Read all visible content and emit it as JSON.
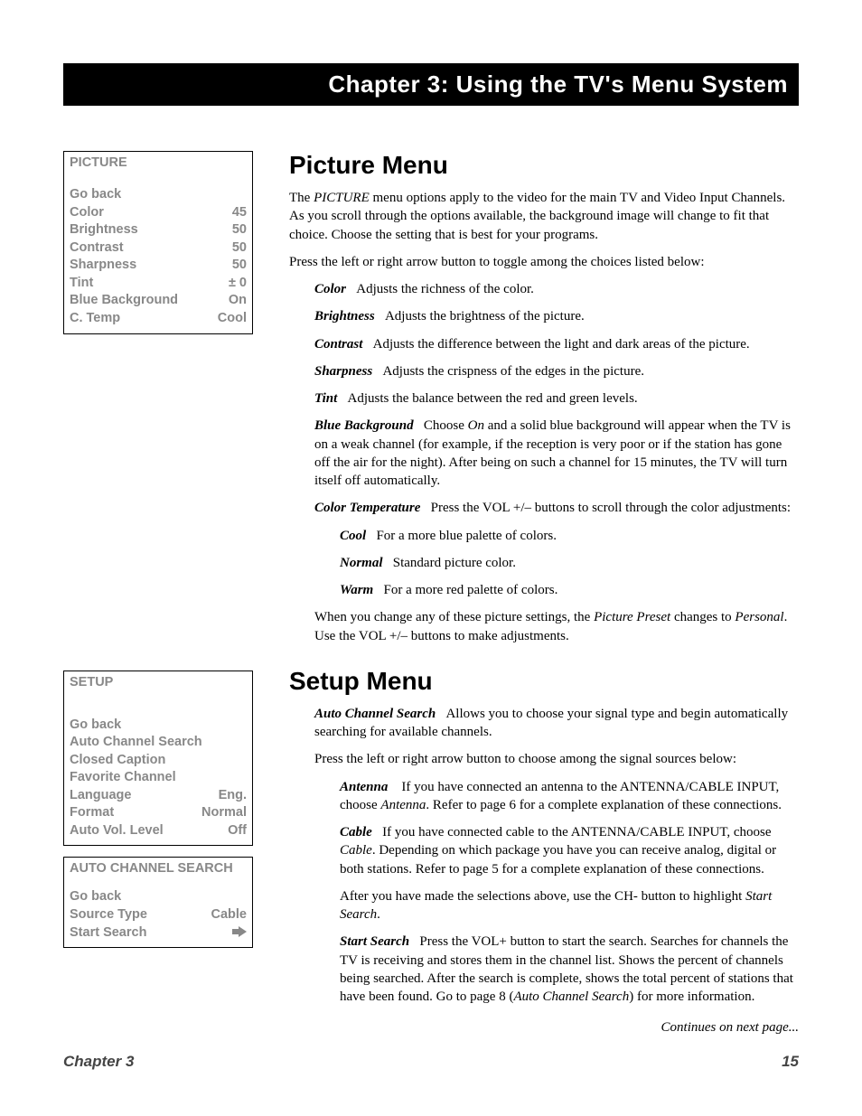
{
  "chapter_banner": "Chapter 3: Using the TV's Menu System",
  "sidebar": {
    "picture_menu": {
      "title": "PICTURE",
      "go_back": "Go back",
      "rows": [
        {
          "label": "Color",
          "value": "45"
        },
        {
          "label": "Brightness",
          "value": "50"
        },
        {
          "label": "Contrast",
          "value": "50"
        },
        {
          "label": "Sharpness",
          "value": "50"
        },
        {
          "label": "Tint",
          "value": "±  0"
        },
        {
          "label": "Blue Background",
          "value": "On"
        },
        {
          "label": "C. Temp",
          "value": "Cool"
        }
      ]
    },
    "setup_menu": {
      "title": "SETUP",
      "go_back": "Go back",
      "rows": [
        {
          "label": "Auto Channel Search",
          "value": ""
        },
        {
          "label": "Closed Caption",
          "value": ""
        },
        {
          "label": "Favorite Channel",
          "value": ""
        },
        {
          "label": "Language",
          "value": "Eng."
        },
        {
          "label": "Format",
          "value": "Normal"
        },
        {
          "label": "Auto Vol. Level",
          "value": "Off"
        }
      ]
    },
    "auto_channel_menu": {
      "title": "AUTO CHANNEL SEARCH",
      "go_back": "Go back",
      "rows": [
        {
          "label": "Source Type",
          "value": "Cable"
        },
        {
          "label": "Start Search",
          "value": "arrow"
        }
      ]
    }
  },
  "main": {
    "picture_heading": "Picture Menu",
    "picture_intro_pre": "The ",
    "picture_intro_italic": "PICTURE",
    "picture_intro_post": " menu options apply to the video for the main TV and Video Input Channels. As you scroll through the options available, the background image will change to fit that choice. Choose the setting that is best for your programs.",
    "picture_press": "Press the left or right arrow button to toggle among the choices listed below:",
    "defs": {
      "color": {
        "term": "Color",
        "desc": "Adjusts the richness of the color."
      },
      "brightness": {
        "term": "Brightness",
        "desc": "Adjusts the brightness of the picture."
      },
      "contrast": {
        "term": "Contrast",
        "desc": "Adjusts the difference between the light and dark areas of the picture."
      },
      "sharpness": {
        "term": "Sharpness",
        "desc": "Adjusts the crispness of the edges in the picture."
      },
      "tint": {
        "term": "Tint",
        "desc": "Adjusts the balance between the red and green levels."
      },
      "bluebg": {
        "term": "Blue Background",
        "desc_pre": "Choose ",
        "desc_italic": "On",
        "desc_post": " and a solid blue background will appear when the TV is on a weak channel (for example, if the reception is very poor or if the station has gone off the air for the night). After being on such a channel for 15 minutes, the TV will turn itself off automatically."
      },
      "ctemp": {
        "term": "Color Temperature",
        "desc": "Press the VOL +/– buttons to scroll through the color adjustments:"
      },
      "cool": {
        "term": "Cool",
        "desc": "For a more blue palette of colors."
      },
      "normal": {
        "term": "Normal",
        "desc": "Standard picture color."
      },
      "warm": {
        "term": "Warm",
        "desc": "For a more red palette of colors."
      }
    },
    "picture_note_pre": "When you change any of these picture settings, the ",
    "picture_note_it1": "Picture Preset",
    "picture_note_mid": " changes to ",
    "picture_note_it2": "Personal",
    "picture_note_post": ". Use the VOL +/– buttons to make adjustments.",
    "setup_heading": "Setup Menu",
    "setup_defs": {
      "acs": {
        "term": "Auto Channel Search",
        "desc": "Allows you to choose your signal type and begin automatically searching for available channels."
      }
    },
    "setup_press": "Press the left or right arrow button to choose among the signal sources below:",
    "antenna": {
      "term": "Antenna",
      "desc_pre": "If you have connected an antenna to the ANTENNA/CABLE INPUT, choose ",
      "desc_italic": "Antenna",
      "desc_post": ". Refer to page 6 for a complete explanation of these connections."
    },
    "cable": {
      "term": "Cable",
      "desc_pre": "If you have connected cable to the ANTENNA/CABLE INPUT, choose ",
      "desc_italic": "Cable",
      "desc_post": ". Depending on which package you have you can receive analog, digital or both stations. Refer to page 5 for a complete explanation of these connections."
    },
    "after_pre": "After you have made the selections above, use the CH- button to highlight ",
    "after_italic": "Start Search",
    "after_post": ".",
    "start_search": {
      "term": "Start Search",
      "desc_pre": "Press the VOL+ button to start the search. Searches for channels the TV is receiving and stores them in the channel list. Shows the percent of channels being searched. After the search is complete, shows the total percent of stations that have been found. Go to page 8 (",
      "desc_italic": "Auto Channel Search",
      "desc_post": ") for more information."
    },
    "continues": "Continues on next page..."
  },
  "footer": {
    "left": "Chapter 3",
    "right": "15"
  }
}
